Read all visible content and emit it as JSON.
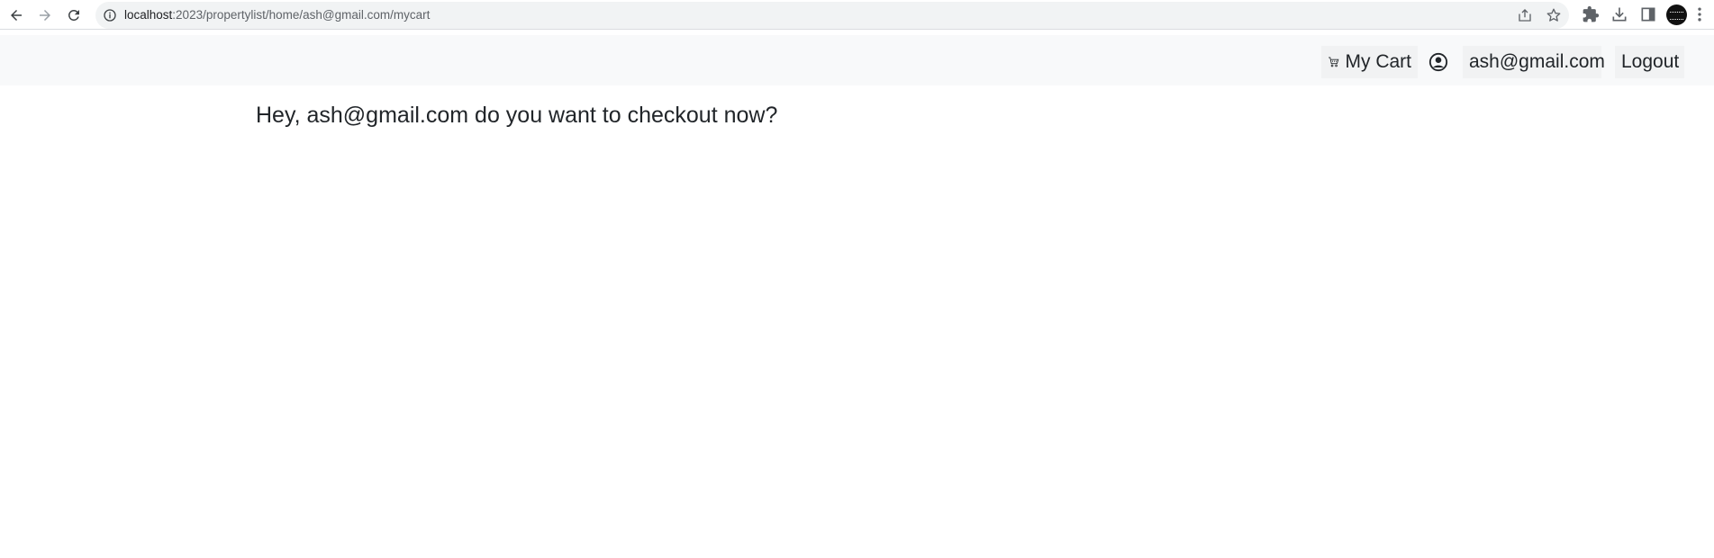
{
  "browser": {
    "url_host": "localhost",
    "url_path": ":2023/propertylist/home/ash@gmail.com/mycart"
  },
  "navbar": {
    "cart_label": "My Cart",
    "user_email": "ash@gmail.com",
    "logout_label": "Logout"
  },
  "main": {
    "heading": "Hey, ash@gmail.com do you want to checkout now?"
  },
  "colors": {
    "navbar_bg": "#f8f9fa",
    "text": "#212529",
    "omnibox_bg": "#f1f3f4"
  }
}
